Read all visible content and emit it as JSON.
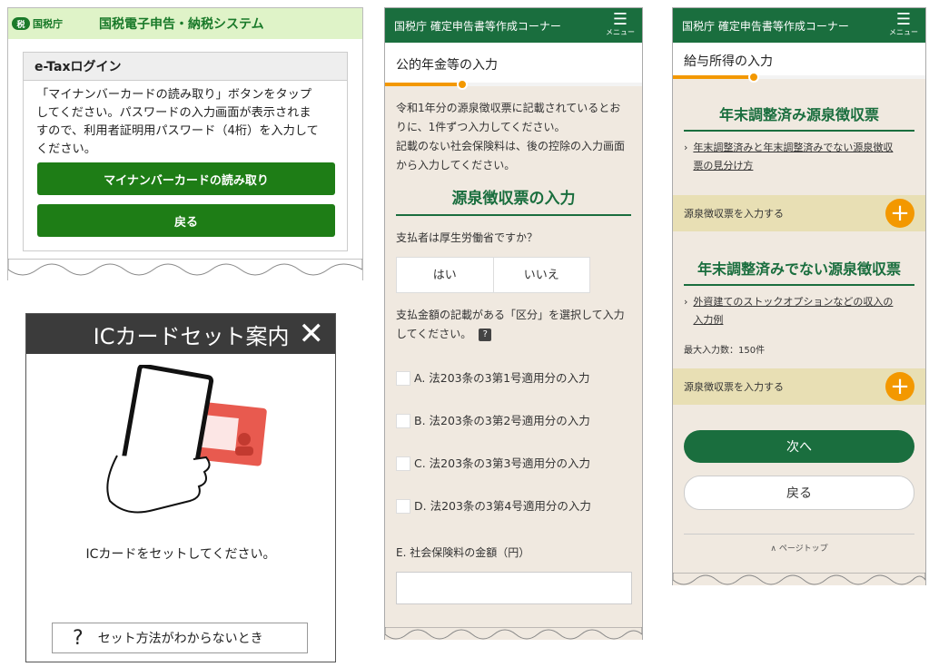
{
  "panel_login": {
    "logo_text": "国税庁",
    "system_title": "国税電子申告・納税システム",
    "box_title": "e-Taxログイン",
    "message_lines": [
      "「マイナンバーカードの読み取り」ボタンをタップ",
      "してください。パスワードの入力画面が表示されま",
      "すので、利用者証明用パスワード（4桁）を入力して",
      "ください。"
    ],
    "read_button": "マイナンバーカードの読み取り",
    "back_button": "戻る"
  },
  "panel_card": {
    "header_title": "ICカードセット案内",
    "close_icon": "✕",
    "instruction": "ICカードをセットしてください。",
    "help_icon": "?",
    "help_button": "セット方法がわからないとき"
  },
  "panel_pension": {
    "app_title": "国税庁 確定申告書等作成コーナー",
    "menu_label": "メニュー",
    "page_title": "公的年金等の入力",
    "progress": 0.3,
    "intro_lines": [
      "令和1年分の源泉徴収票に記載されているとお",
      "りに、1件ずつ入力してください。",
      "記載のない社会保険料は、後の控除の入力画面",
      "から入力してください。"
    ],
    "section_title": "源泉徴収票の入力",
    "question": "支払者は厚生労働省ですか？",
    "yes_label": "はい",
    "no_label": "いいえ",
    "category_prompt_line1": "支払金額の記載がある「区分」を選択して入力",
    "category_prompt_line2": "してください。",
    "help_mark": "?",
    "options": [
      "A. 法203条の3第1号適用分の入力",
      "B. 法203条の3第2号適用分の入力",
      "C. 法203条の3第3号適用分の入力",
      "D. 法203条の3第4号適用分の入力"
    ],
    "insurance_label": "E. 社会保険料の金額（円）"
  },
  "panel_salary": {
    "app_title": "国税庁 確定申告書等作成コーナー",
    "menu_label": "メニュー",
    "page_title": "給与所得の入力",
    "progress": 0.32,
    "section1_title": "年末調整済み源泉徴収票",
    "section1_link_lines": [
      "年末調整済みと年末調整済みでない源泉徴収",
      "票の見分け方"
    ],
    "add_label_1": "源泉徴収票を入力する",
    "section2_title": "年末調整済みでない源泉徴収票",
    "section2_link_lines": [
      "外資建てのストックオプションなどの収入の",
      "入力例"
    ],
    "max_entries": "最大入力数：150件",
    "add_label_2": "源泉徴収票を入力する",
    "next_button": "次へ",
    "back_button": "戻る",
    "page_top": "ページトップ"
  },
  "colors": {
    "etax_green": "#1e7d16",
    "header_green": "#1a6e3e",
    "accent_orange": "#f39800",
    "panel_beige": "#f0e9e0"
  }
}
